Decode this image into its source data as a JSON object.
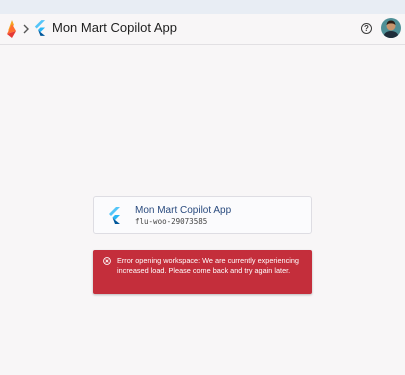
{
  "header": {
    "app_title": "Mon Mart Copilot App",
    "help_glyph": "?",
    "icons": {
      "logo": "firebase-logo-icon",
      "separator": "chevron-right-icon",
      "app": "flutter-icon",
      "help": "help-icon",
      "avatar": "user-avatar"
    }
  },
  "workspace_card": {
    "title": "Mon Mart Copilot App",
    "id": "flu-woo-29073585",
    "icon": "flutter-icon"
  },
  "error_banner": {
    "icon": "error-circle-x-icon",
    "message": "Error opening workspace: We are currently experiencing increased load. Please come back and try again later."
  },
  "colors": {
    "background": "#f8f6f7",
    "error_background": "#c42e3b",
    "card_title": "#294a7e"
  }
}
